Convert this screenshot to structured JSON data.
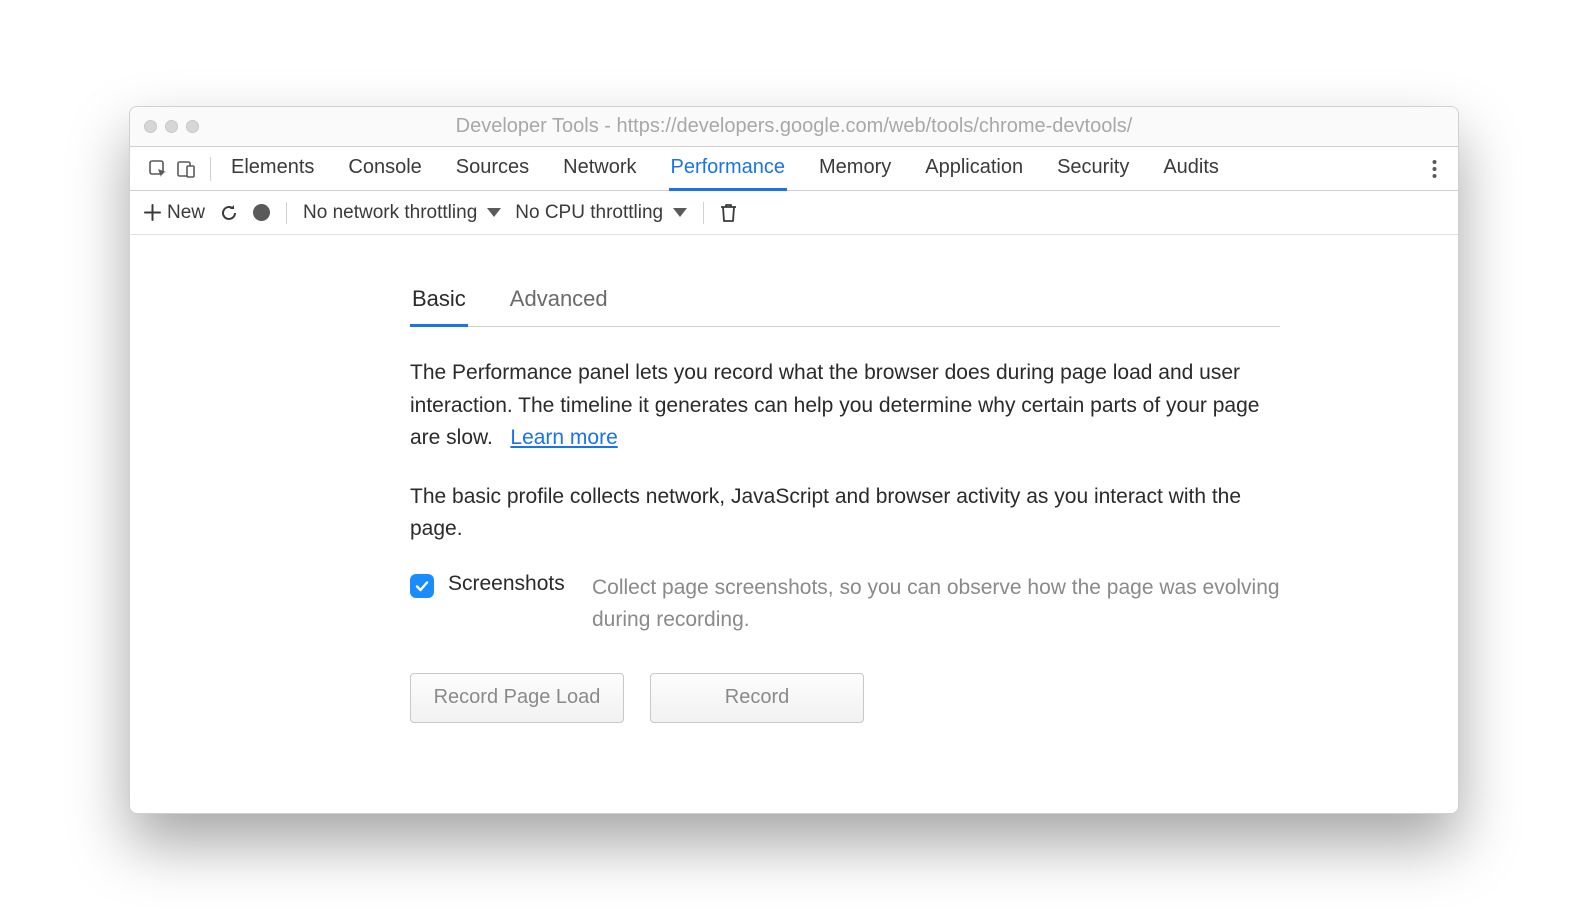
{
  "window": {
    "title": "Developer Tools - https://developers.google.com/web/tools/chrome-devtools/"
  },
  "tabs": {
    "elements": "Elements",
    "console": "Console",
    "sources": "Sources",
    "network": "Network",
    "performance": "Performance",
    "memory": "Memory",
    "application": "Application",
    "security": "Security",
    "audits": "Audits",
    "active": "performance"
  },
  "toolbar": {
    "new_label": "New",
    "network_throttling": "No network throttling",
    "cpu_throttling": "No CPU throttling"
  },
  "subtabs": {
    "basic": "Basic",
    "advanced": "Advanced",
    "active": "basic"
  },
  "content": {
    "intro": "The Performance panel lets you record what the browser does during page load and user interaction. The timeline it generates can help you determine why certain parts of your page are slow.",
    "learn_more": "Learn more",
    "basic_desc": "The basic profile collects network, JavaScript and browser activity as you interact with the page.",
    "screenshots_label": "Screenshots",
    "screenshots_desc": "Collect page screenshots, so you can observe how the page was evolving during recording.",
    "screenshots_checked": true,
    "record_page_load": "Record Page Load",
    "record": "Record"
  }
}
